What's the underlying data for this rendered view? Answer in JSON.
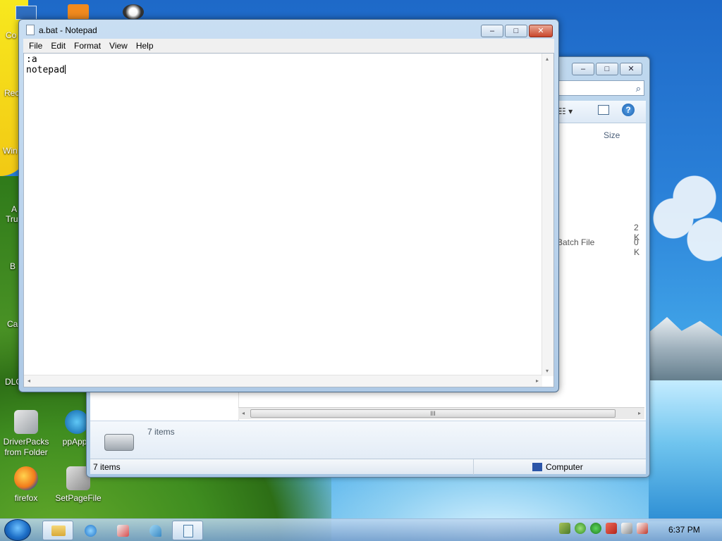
{
  "desktop": {
    "icons": [
      {
        "label": "DriverPacks from Folder"
      },
      {
        "label": "ppApps"
      },
      {
        "label": "firefox"
      },
      {
        "label": "SetPageFile"
      }
    ],
    "partial_labels": [
      "Co",
      "Rec",
      "Win",
      "A",
      "Tru",
      "B",
      "Ca",
      "DLC"
    ]
  },
  "explorer": {
    "column_size": "Size",
    "rows": [
      {
        "type": "",
        "size": "2 K"
      },
      {
        "type": "Batch File",
        "size": "0 K"
      }
    ],
    "details_count": "7 items",
    "status_items": "7 items",
    "status_location": "Computer",
    "scroll_grip": "III"
  },
  "notepad": {
    "title": "a.bat - Notepad",
    "menu": [
      "File",
      "Edit",
      "Format",
      "View",
      "Help"
    ],
    "content_line1": ":a",
    "content_line2": "notepad",
    "caption": {
      "minimize": "–",
      "maximize": "□",
      "close": "✕"
    }
  },
  "taskbar": {
    "clock": "6:37 PM",
    "pinned": [
      "explorer-folder-icon",
      "internet-explorer-icon",
      "paint-icon",
      "bird-icon",
      "notepad-icon"
    ]
  }
}
